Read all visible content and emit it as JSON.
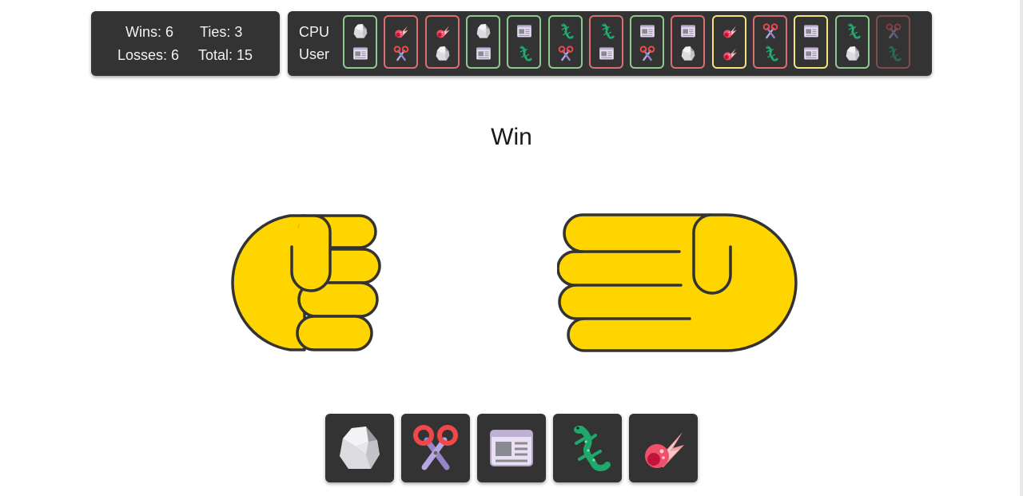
{
  "score": {
    "wins": "Wins: 6",
    "ties": "Ties: 3",
    "losses": "Losses: 6",
    "total": "Total: 15"
  },
  "history": {
    "cpu_label": "CPU",
    "user_label": "User",
    "rounds": [
      {
        "cpu": "rock",
        "user": "paper",
        "outcome": "win"
      },
      {
        "cpu": "meteor",
        "user": "scissors",
        "outcome": "loss"
      },
      {
        "cpu": "meteor",
        "user": "rock",
        "outcome": "loss"
      },
      {
        "cpu": "rock",
        "user": "paper",
        "outcome": "win"
      },
      {
        "cpu": "paper",
        "user": "lizard",
        "outcome": "win"
      },
      {
        "cpu": "lizard",
        "user": "scissors",
        "outcome": "win"
      },
      {
        "cpu": "lizard",
        "user": "paper",
        "outcome": "loss"
      },
      {
        "cpu": "paper",
        "user": "scissors",
        "outcome": "win"
      },
      {
        "cpu": "paper",
        "user": "rock",
        "outcome": "loss"
      },
      {
        "cpu": "meteor",
        "user": "meteor",
        "outcome": "tie"
      },
      {
        "cpu": "scissors",
        "user": "lizard",
        "outcome": "loss"
      },
      {
        "cpu": "paper",
        "user": "paper",
        "outcome": "tie"
      },
      {
        "cpu": "lizard",
        "user": "rock",
        "outcome": "win"
      },
      {
        "cpu": "scissors",
        "user": "lizard",
        "outcome": "loss"
      }
    ]
  },
  "result_text": "Win",
  "cpu_hand": "fist",
  "user_hand": "flat-hand",
  "choices": [
    "rock",
    "scissors",
    "paper",
    "lizard",
    "meteor"
  ],
  "colors": {
    "panel": "#333333",
    "win_border": "#8fc98f",
    "loss_border": "#d9706f",
    "tie_border": "#f2e37a",
    "hand_fill": "#ffd500",
    "hand_stroke": "#333333"
  }
}
